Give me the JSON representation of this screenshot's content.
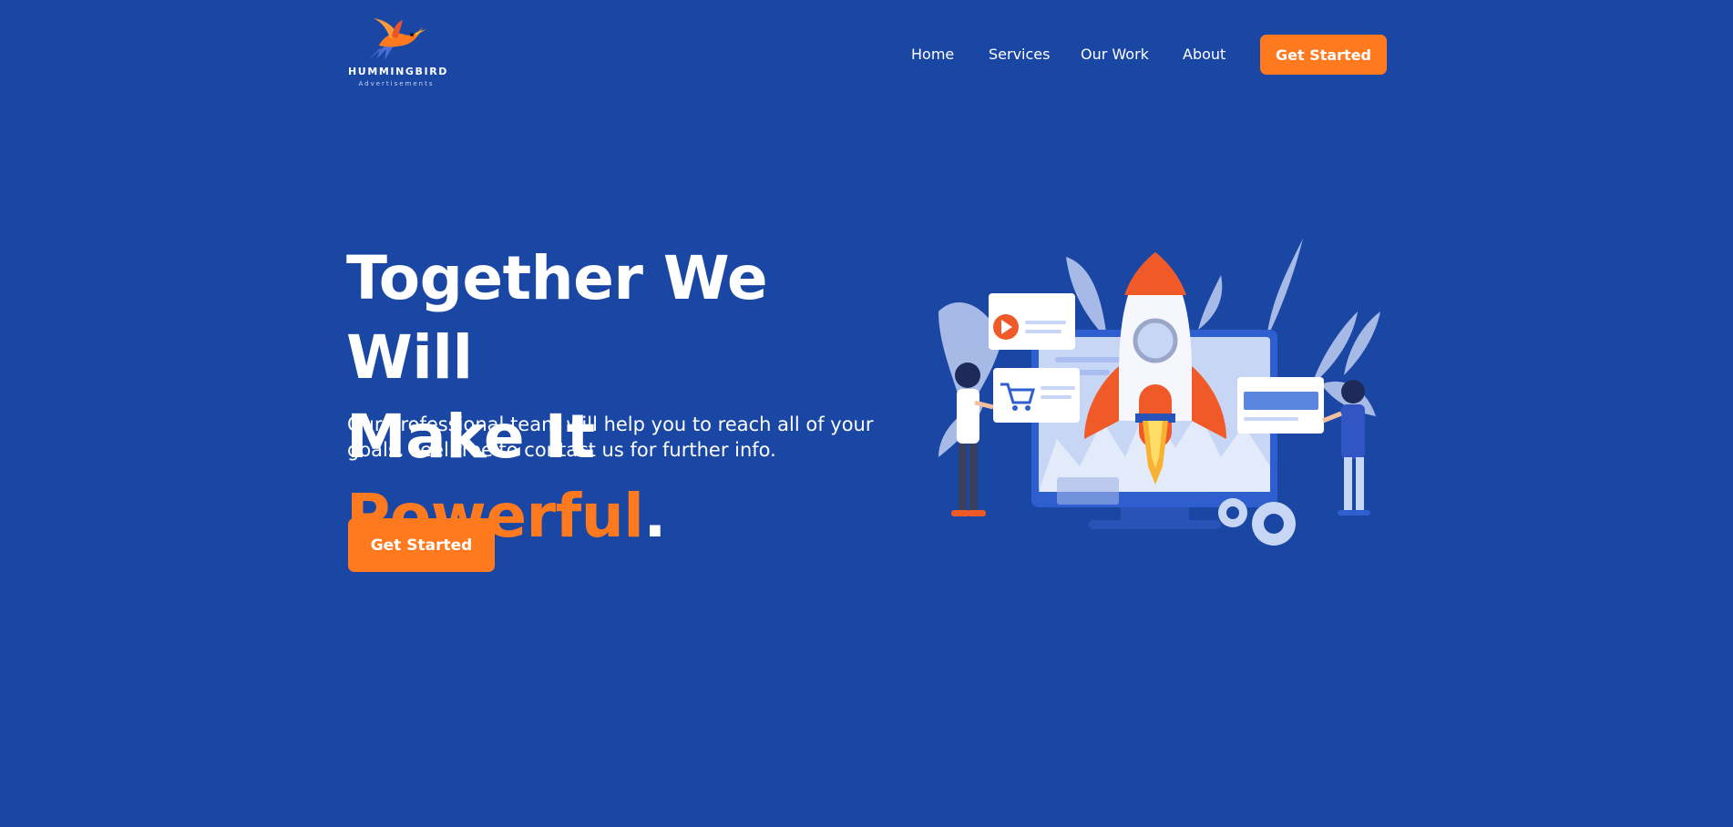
{
  "brand": {
    "name": "HUMMINGBIRD",
    "tagline": "Advertisements",
    "colors": {
      "accent": "#ff7a1f",
      "background": "#1a47a3",
      "text": "#ffffff"
    }
  },
  "nav": {
    "links": [
      {
        "label": "Home"
      },
      {
        "label": "Services"
      },
      {
        "label": "Our Work"
      },
      {
        "label": "About"
      }
    ],
    "cta_label": "Get Started"
  },
  "hero": {
    "headline_line1": "Together We Will",
    "headline_line2_prefix": "Make It ",
    "headline_accent": "Powerful",
    "headline_suffix": ".",
    "subtext": "Our professional team will help you to reach all of your goals. Feel free to contact us for further info.",
    "cta_label": "Get Started",
    "illustration_icon": "rocket-launch-illustration"
  }
}
